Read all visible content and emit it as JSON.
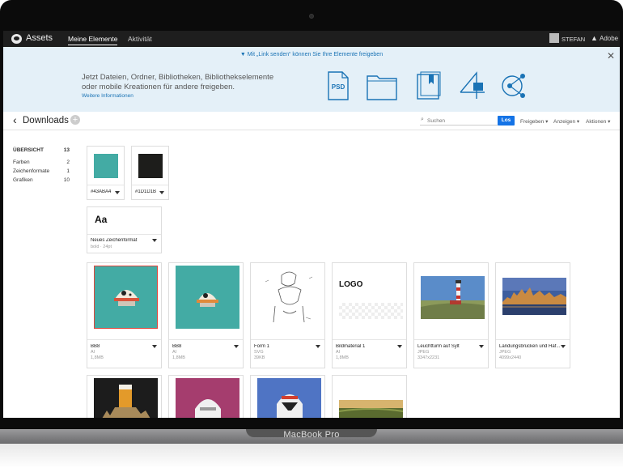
{
  "device": {
    "model": "MacBook Pro"
  },
  "topbar": {
    "brand": "Assets",
    "tabs": [
      {
        "label": "Meine Elemente",
        "active": true
      },
      {
        "label": "Aktivität",
        "active": false
      }
    ],
    "user": "STEFAN",
    "adobe": "Adobe"
  },
  "banner": {
    "link_hint": "▼ Mit „Link senden“ können Sie Ihre Elemente freigeben",
    "headline": "Jetzt Dateien, Ordner, Bibliotheken, Bibliothekselemente oder mobile Kreationen für andere freigeben.",
    "more": "Weitere Informationen",
    "psd_label": "PSD",
    "icons": [
      "psd-file-icon",
      "folder-icon",
      "library-icon",
      "mobile-creation-icon",
      "share-icon"
    ]
  },
  "header": {
    "title": "Downloads",
    "search_placeholder": "Suchen",
    "go": "Los",
    "menus": [
      "Freigeben",
      "Anzeigen",
      "Aktionen"
    ]
  },
  "sidebar": {
    "items": [
      {
        "label": "ÜBERSICHT",
        "count": "13"
      },
      {
        "label": "Farben",
        "count": "2"
      },
      {
        "label": "Zeichenformate",
        "count": "1"
      },
      {
        "label": "Grafiken",
        "count": "10"
      }
    ]
  },
  "colors": [
    {
      "name": "#43ABA4",
      "hex": "#43ABA4"
    },
    {
      "name": "#1D1D1B",
      "hex": "#1D1D1B"
    }
  ],
  "charstyle": {
    "sample": "Aa",
    "name": "Neues Zeichenformat",
    "meta": "bold · 24pt"
  },
  "graphics": [
    {
      "name": "BB8",
      "type": "AI",
      "size": "1,8MB"
    },
    {
      "name": "BB8",
      "type": "AI",
      "size": "1,8MB"
    },
    {
      "name": "Form 1",
      "type": "SVG",
      "size": "39KB"
    },
    {
      "name": "Bildmaterial 1",
      "type": "AI",
      "size": "1,8MB",
      "logo": "LOGO"
    },
    {
      "name": "Leuchtturm auf Sylt",
      "type": "JPEG",
      "size": "3347x2231"
    },
    {
      "name": "Landungsbrücken und Haf...",
      "type": "JPEG",
      "size": "4099x2440"
    }
  ]
}
